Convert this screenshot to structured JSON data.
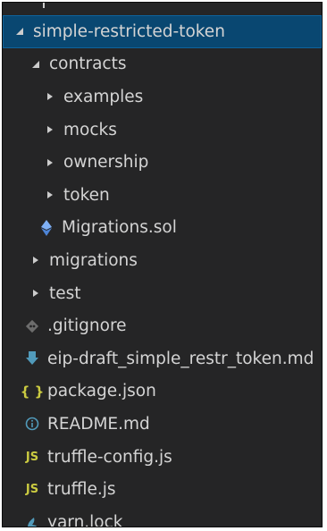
{
  "explorer": {
    "root": {
      "label": "simple-restricted-token",
      "expanded": true
    },
    "items": [
      {
        "label": "contracts",
        "type": "folder",
        "depth": 1,
        "expanded": true
      },
      {
        "label": "examples",
        "type": "folder",
        "depth": 2,
        "expanded": false
      },
      {
        "label": "mocks",
        "type": "folder",
        "depth": 2,
        "expanded": false
      },
      {
        "label": "ownership",
        "type": "folder",
        "depth": 2,
        "expanded": false
      },
      {
        "label": "token",
        "type": "folder",
        "depth": 2,
        "expanded": false
      },
      {
        "label": "Migrations.sol",
        "type": "file",
        "depth": 2,
        "icon": "solidity-icon"
      },
      {
        "label": "migrations",
        "type": "folder",
        "depth": 1,
        "expanded": false
      },
      {
        "label": "test",
        "type": "folder",
        "depth": 1,
        "expanded": false
      },
      {
        "label": ".gitignore",
        "type": "file",
        "depth": 1,
        "icon": "git-icon"
      },
      {
        "label": "eip-draft_simple_restr_token.md",
        "type": "file",
        "depth": 1,
        "icon": "markdown-download-icon"
      },
      {
        "label": "package.json",
        "type": "file",
        "depth": 1,
        "icon": "json-braces-icon"
      },
      {
        "label": "README.md",
        "type": "file",
        "depth": 1,
        "icon": "info-icon"
      },
      {
        "label": "truffle-config.js",
        "type": "file",
        "depth": 1,
        "icon": "javascript-icon"
      },
      {
        "label": "truffle.js",
        "type": "file",
        "depth": 1,
        "icon": "javascript-icon"
      },
      {
        "label": "yarn.lock",
        "type": "file",
        "depth": 1,
        "icon": "yarn-icon"
      }
    ],
    "icon_text": {
      "json": "{ }",
      "js": "JS"
    },
    "colors": {
      "background": "#252526",
      "selected_row": "#094771",
      "text": "#cccccc",
      "solidity": "#63a0f0",
      "git": "#6d6d6d",
      "markdown": "#519aba",
      "json": "#cbcb41",
      "info": "#519aba",
      "javascript": "#cbcb41",
      "yarn": "#519aba"
    }
  }
}
